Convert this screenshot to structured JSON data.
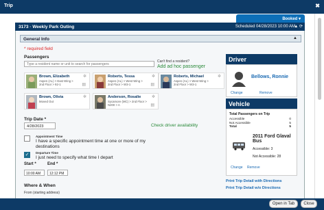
{
  "window": {
    "title": "Trip",
    "close_label": "✖"
  },
  "status": {
    "booked_label": "Booked ▾"
  },
  "trip": {
    "name": "3173 · Weekly Park Outing",
    "scheduled": "Scheduled 04/28/2023 10:00 AM",
    "controls": "▲ ⟳"
  },
  "general_info": {
    "label": "General Info",
    "collapse_icon": "▲"
  },
  "required_note": "* required field",
  "passengers": {
    "label": "Passengers",
    "search_placeholder": "Type a resident name or unit to search for passengers",
    "cant_find": "Can't find a resident?",
    "adhoc_link": "Add ad hoc passenger",
    "items": [
      {
        "name": "Brown, Elizabeth",
        "sub": "Aspen (AL) > East Wing > 2nd Floor > 92-1"
      },
      {
        "name": "Roberts, Tessa",
        "sub": "Aspen (AL) > West Wing > 2nd Floor > W3-1"
      },
      {
        "name": "Roberts, Michael",
        "sub": "Aspen (AL) > West Wing > 2nd Floor > W3-1"
      },
      {
        "name": "Brown, Olivia",
        "sub": "Moved Out"
      },
      {
        "name": "Anderson, Rosalie",
        "sub": "Sycamore (MC) > 2nd Floor > N200 > A"
      }
    ]
  },
  "trip_date": {
    "label": "Trip Date *",
    "value": "4/28/2023",
    "check_availability": "Check driver availability"
  },
  "time_options": {
    "appointment_title": "Appointment Time",
    "appointment_desc": "I have a specific appointment time at one or more of my destinations",
    "departure_title": "Departure Time",
    "departure_desc": "I just need to specify what time I depart",
    "departure_checked": true
  },
  "times": {
    "start_label": "Start *",
    "start_value": "10:00 AM",
    "end_label": "End *",
    "end_value": "12:12 PM"
  },
  "where_when": {
    "label": "Where & When",
    "from_label": "From (starting address)"
  },
  "driver": {
    "header": "Driver",
    "name": "Bellows, Ronnie",
    "change": "Change",
    "remove": "Remove"
  },
  "vehicle": {
    "header": "Vehicle",
    "totals_title": "Total Passengers on Trip",
    "rows": [
      {
        "label": "Accessible",
        "value": "0"
      },
      {
        "label": "Not Accessible",
        "value": "5"
      },
      {
        "label": "Total",
        "value": "5"
      }
    ],
    "name": "2011 Ford Glaval Bus",
    "accessible": "Accessible: 3",
    "not_accessible": "Not Accessible: 28",
    "change": "Change",
    "remove": "Remove"
  },
  "print_links": {
    "with_dir": "Print Trip Detail with Directions",
    "without_dir": "Print Trip Detail w/o Directions"
  },
  "footer": {
    "open_tab": "Open in Tab",
    "close": "Close"
  }
}
